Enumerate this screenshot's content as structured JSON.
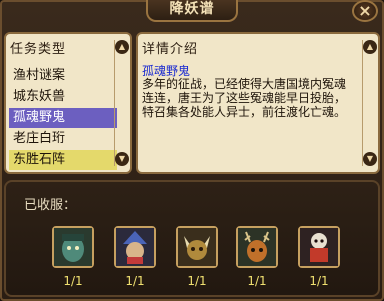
{
  "window": {
    "title": "降妖谱",
    "close_label": "×"
  },
  "left_panel": {
    "header": "任务类型",
    "items": [
      {
        "label": "渔村谜案",
        "state": "normal"
      },
      {
        "label": "城东妖兽",
        "state": "normal"
      },
      {
        "label": "孤魂野鬼",
        "state": "selected"
      },
      {
        "label": "老庄白珩",
        "state": "normal"
      },
      {
        "label": "东胜石阵",
        "state": "highlight"
      }
    ]
  },
  "right_panel": {
    "header": "详情介绍",
    "name": "孤魂野鬼",
    "text": "多年的征战，已经使得大唐国境内冤魂连连，唐王为了这些冤魂能早日投胎，特召集各处能人异士，前往渡化亡魂。"
  },
  "collection": {
    "label": "已收服：",
    "monsters": [
      {
        "icon": "green-ghost-monster-icon",
        "count": "1/1",
        "color": "#4f8a7a"
      },
      {
        "icon": "blue-hat-monster-icon",
        "count": "1/1",
        "color": "#4a64b8"
      },
      {
        "icon": "horned-beast-monster-icon",
        "count": "1/1",
        "color": "#b08a3c"
      },
      {
        "icon": "antlered-beast-monster-icon",
        "count": "1/1",
        "color": "#c0702a"
      },
      {
        "icon": "red-demon-monster-icon",
        "count": "1/1",
        "color": "#c23a2a"
      }
    ]
  }
}
